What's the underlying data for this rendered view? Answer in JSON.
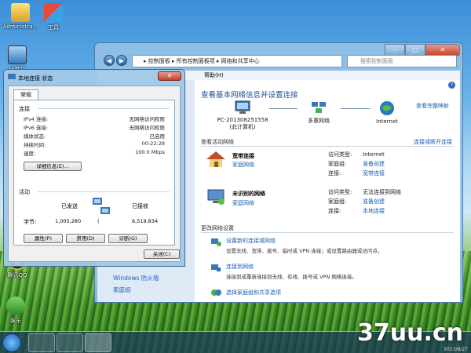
{
  "desktop": {
    "icons": [
      {
        "label": "Administra..."
      },
      {
        "label": "工具"
      },
      {
        "label": "计算机"
      },
      {
        "label": "腾讯QQ"
      },
      {
        "label": "娱乐"
      }
    ]
  },
  "main_window": {
    "address_path": "▸ 控制面板 ▸ 所有控制面板项 ▸ 网络和共享中心",
    "search_placeholder": "搜索控制面板",
    "menu_help": "帮助(H)",
    "title": "查看基本网络信息并设置连接",
    "view_full_map": "查看完整映射",
    "map_nodes": [
      {
        "label": "PC-201308251558\n(此计算机)"
      },
      {
        "label": "多重网络"
      },
      {
        "label": "Internet"
      }
    ],
    "active_networks_label": "查看活动网络",
    "connect_or_disconnect": "连接或断开连接",
    "networks": [
      {
        "name": "宽带连接",
        "type": "家庭网络",
        "access_type_label": "访问类型:",
        "access_type": "Internet",
        "homegroup_label": "家庭组:",
        "homegroup": "准备创建",
        "connection_label": "连接:",
        "connection": "宽带连接"
      },
      {
        "name": "未识别的网络",
        "type": "家庭网络",
        "access_type_label": "访问类型:",
        "access_type": "无法连接到网络",
        "homegroup_label": "家庭组:",
        "homegroup": "准备创建",
        "connection_label": "连接:",
        "connection": "本地连接"
      }
    ],
    "change_settings_label": "更改网络设置",
    "tasks": [
      {
        "title": "设置新的连接或网络",
        "desc": "设置无线、宽带、拨号、临时或 VPN 连接；或设置路由器或访问点。"
      },
      {
        "title": "连接到网络",
        "desc": "连接到或重新连接到无线、有线、拨号或 VPN 网络连接。"
      },
      {
        "title": "选择家庭组和共享选项",
        "desc": ""
      }
    ],
    "left_links": [
      "Windows 防火墙",
      "家庭组"
    ]
  },
  "dialog": {
    "title": "本地连接 状态",
    "tab": "常规",
    "connection_group": "连接",
    "rows": [
      {
        "label": "IPv4 连接:",
        "value": "无网络访问权限"
      },
      {
        "label": "IPv6 连接:",
        "value": "无网络访问权限"
      },
      {
        "label": "媒体状态:",
        "value": "已启用"
      },
      {
        "label": "持续时间:",
        "value": "00:22:28"
      },
      {
        "label": "速度:",
        "value": "100.0 Mbps"
      }
    ],
    "details_button": "详细信息(E)...",
    "activity_group": "活动",
    "sent_label": "已发送",
    "received_label": "已接收",
    "bytes_label": "字节:",
    "bytes_sent": "1,005,280",
    "bytes_received": "6,519,834",
    "properties_button": "属性(P)",
    "disable_button": "禁用(D)",
    "diagnose_button": "诊断(G)",
    "close_button": "关闭(C)"
  },
  "watermark": "37uu.cn",
  "datestamp": "2013/8/27"
}
